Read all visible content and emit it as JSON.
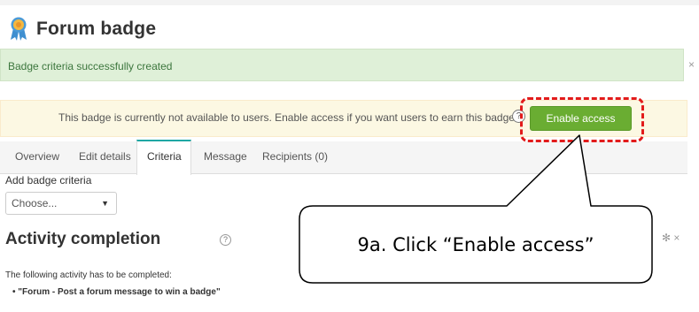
{
  "header": {
    "title": "Forum badge",
    "icon": "badge-ribbon-icon"
  },
  "alerts": {
    "success_text": "Badge criteria successfully created",
    "close_glyph": "×",
    "warning_text": "This badge is currently not available to users. Enable access if you want users to earn this badge.",
    "help_glyph": "?",
    "enable_button_label": "Enable access"
  },
  "tabs": [
    {
      "label": "Overview"
    },
    {
      "label": "Edit details"
    },
    {
      "label": "Criteria"
    },
    {
      "label": "Message"
    },
    {
      "label": "Recipients (0)"
    }
  ],
  "active_tab": "Criteria",
  "criteria": {
    "add_label": "Add badge criteria",
    "select_value": "Choose...",
    "caret_glyph": "▼"
  },
  "section": {
    "title": "Activity completion",
    "help_glyph": "?",
    "actions_glyph": "✻ ×",
    "intro_text": "The following activity has to be completed:",
    "item_text": "• \"Forum - Post a forum message to win a badge\""
  },
  "callout": {
    "text": "9a. Click “Enable access”"
  },
  "colors": {
    "success_bg": "#dff0d8",
    "warning_bg": "#fcf8e3",
    "button_green": "#6aad32",
    "highlight_red": "#e21b1b",
    "tab_accent": "#1fa7a4"
  }
}
